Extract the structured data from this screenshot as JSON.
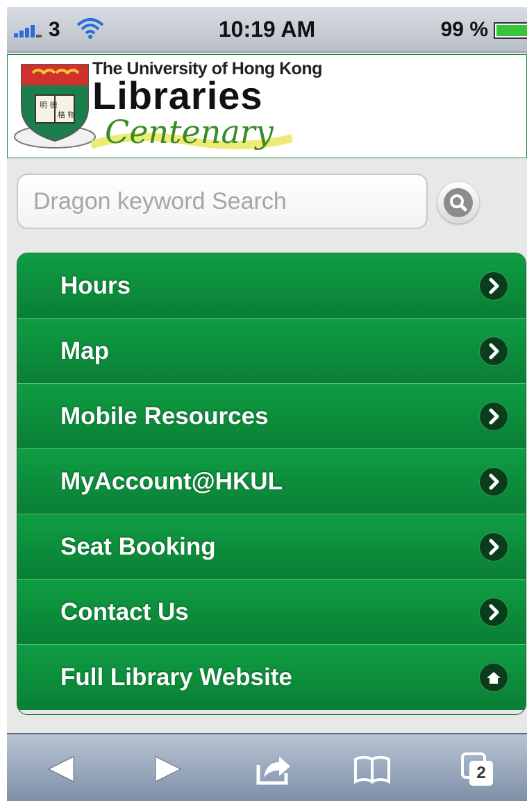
{
  "status_bar": {
    "carrier": "3",
    "time": "10:19 AM",
    "battery": "99 %"
  },
  "header": {
    "logo_line1": "The University of Hong Kong",
    "logo_line2": "Libraries",
    "logo_line3": "Centenary"
  },
  "search": {
    "placeholder": "Dragon keyword Search",
    "button_icon": "search-icon"
  },
  "menu": {
    "items": [
      {
        "label": "Hours",
        "icon": "chevron-right-icon"
      },
      {
        "label": "Map",
        "icon": "chevron-right-icon"
      },
      {
        "label": "Mobile Resources",
        "icon": "chevron-right-icon"
      },
      {
        "label": "MyAccount@HKUL",
        "icon": "chevron-right-icon"
      },
      {
        "label": "Seat Booking",
        "icon": "chevron-right-icon"
      },
      {
        "label": "Contact Us",
        "icon": "chevron-right-icon"
      },
      {
        "label": "Full Library Website",
        "icon": "home-icon"
      }
    ]
  },
  "toolbar": {
    "tabs_count": "2",
    "icons": [
      "back-icon",
      "forward-icon",
      "share-icon",
      "bookmarks-icon",
      "tabs-icon"
    ]
  },
  "colors": {
    "menu_green": "#0f9d43",
    "menu_green_dark": "#0a7f35",
    "icon_dark": "#0a3d1c",
    "battery_green": "#37c63a"
  }
}
